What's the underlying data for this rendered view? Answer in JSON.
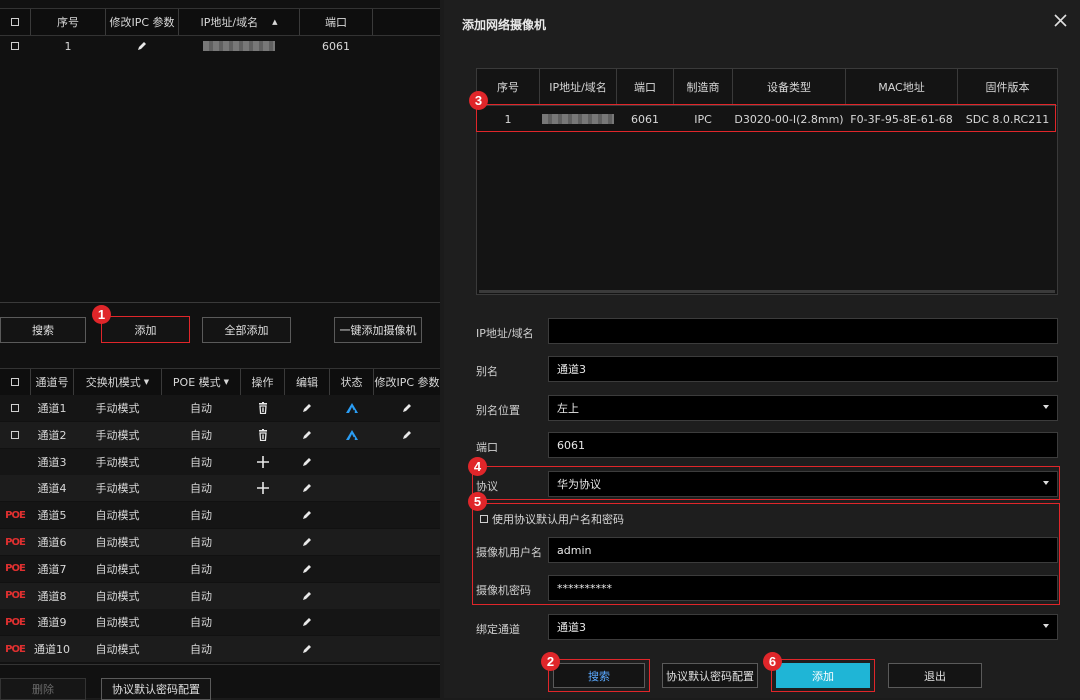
{
  "top_table": {
    "headers": [
      "序号",
      "修改IPC 参数",
      "IP地址/域名",
      "端口"
    ],
    "rows": [
      {
        "index": "1",
        "port": "6061"
      }
    ]
  },
  "left_buttons": {
    "search": "搜索",
    "add": "添加",
    "add_all": "全部添加",
    "one_click": "一键添加摄像机"
  },
  "channel_table": {
    "headers": [
      "通道号",
      "交换机模式",
      "POE 模式",
      "操作",
      "编辑",
      "状态",
      "修改IPC 参数"
    ],
    "rows": [
      {
        "poe": "",
        "channel": "通道1",
        "switch_mode": "手动模式",
        "poe_mode": "自动"
      },
      {
        "poe": "",
        "channel": "通道2",
        "switch_mode": "手动模式",
        "poe_mode": "自动"
      },
      {
        "poe": "",
        "channel": "通道3",
        "switch_mode": "手动模式",
        "poe_mode": "自动"
      },
      {
        "poe": "",
        "channel": "通道4",
        "switch_mode": "手动模式",
        "poe_mode": "自动"
      },
      {
        "poe": "POE",
        "channel": "通道5",
        "switch_mode": "自动模式",
        "poe_mode": "自动"
      },
      {
        "poe": "POE",
        "channel": "通道6",
        "switch_mode": "自动模式",
        "poe_mode": "自动"
      },
      {
        "poe": "POE",
        "channel": "通道7",
        "switch_mode": "自动模式",
        "poe_mode": "自动"
      },
      {
        "poe": "POE",
        "channel": "通道8",
        "switch_mode": "自动模式",
        "poe_mode": "自动"
      },
      {
        "poe": "POE",
        "channel": "通道9",
        "switch_mode": "自动模式",
        "poe_mode": "自动"
      },
      {
        "poe": "POE",
        "channel": "通道10",
        "switch_mode": "自动模式",
        "poe_mode": "自动"
      }
    ]
  },
  "bottom_buttons": {
    "delete": "删除",
    "proto_pwd": "协议默认密码配置"
  },
  "dialog": {
    "title": "添加网络摄像机",
    "result_headers": [
      "序号",
      "IP地址/域名",
      "端口",
      "制造商",
      "设备类型",
      "MAC地址",
      "固件版本"
    ],
    "result_rows": [
      {
        "index": "1",
        "port": "6061",
        "vendor": "IPC",
        "type": "D3020-00-I(2.8mm)",
        "mac": "F0-3F-95-8E-61-68",
        "firmware": "SDC 8.0.RC211"
      }
    ],
    "labels": {
      "ip": "IP地址/域名",
      "alias": "别名",
      "alias_pos": "别名位置",
      "port": "端口",
      "protocol": "协议",
      "use_default": "使用协议默认用户名和密码",
      "username": "摄像机用户名",
      "password": "摄像机密码",
      "bind": "绑定通道"
    },
    "values": {
      "ip": "",
      "alias": "通道3",
      "alias_pos": "左上",
      "port": "6061",
      "protocol": "华为协议",
      "username": "admin",
      "password": "**********",
      "bind": "通道3"
    },
    "buttons": {
      "search": "搜索",
      "proto_pwd": "协议默认密码配置",
      "add": "添加",
      "exit": "退出"
    },
    "accent_color": "#1fb5d6"
  },
  "badges": [
    "1",
    "2",
    "3",
    "4",
    "5",
    "6"
  ]
}
